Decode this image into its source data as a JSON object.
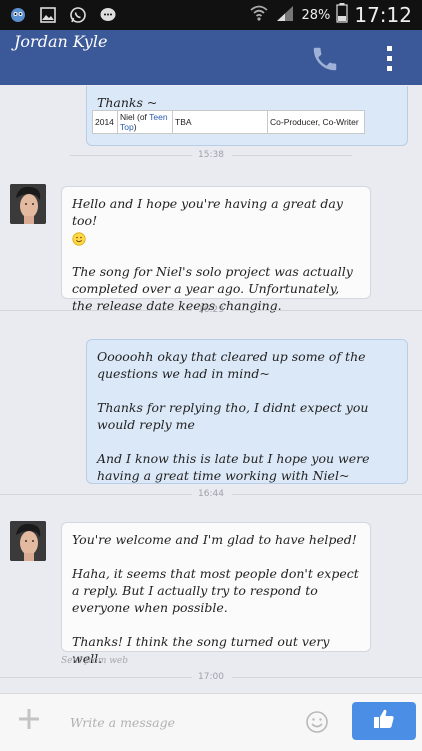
{
  "status_bar": {
    "battery": "28%",
    "time": "17:12"
  },
  "header": {
    "contact_name": "Jordan Kyle"
  },
  "messages": [
    {
      "direction": "out",
      "text": "Thanks ~",
      "table": {
        "year": "2014",
        "name_prefix": "Niel (of ",
        "name_link": "Teen Top",
        "name_suffix": ")",
        "album": "TBA",
        "role": "Co-Producer, Co-Writer"
      },
      "time": "15:38"
    },
    {
      "direction": "in",
      "text": "Hello and I hope you're having a great day too!",
      "emoji": "smiley-emoji",
      "text2": "The song for Niel's solo project was actually completed over a year ago. Unfortunately, the release date keeps changing.",
      "time": "16:23"
    },
    {
      "direction": "out",
      "text": "Ooooohh okay that cleared up some of the questions we had in mind~\n\nThanks for replying tho, I didnt expect you would reply me\n\nAnd I know this is late but I hope you were having a great time working with Niel~",
      "time": "16:44"
    },
    {
      "direction": "in",
      "text": "You're welcome and I'm glad to have helped!\n\nHaha, it seems that most people don't expect a reply. But I actually try to respond to everyone when possible.\n\nThanks! I think the song turned out very well.",
      "footer": "Sent from web",
      "time": "17:00"
    }
  ],
  "composer": {
    "placeholder": "Write a message"
  },
  "icons": {
    "call": "phone-icon",
    "menu": "overflow-menu-icon",
    "add": "plus-icon",
    "emoji": "smiley-icon",
    "like": "thumbs-up-icon"
  },
  "colors": {
    "header": "#3b5998",
    "outgoing_bubble": "#dbe8f7",
    "incoming_bubble": "#fbfbfb",
    "like_button": "#4a8ee6"
  }
}
